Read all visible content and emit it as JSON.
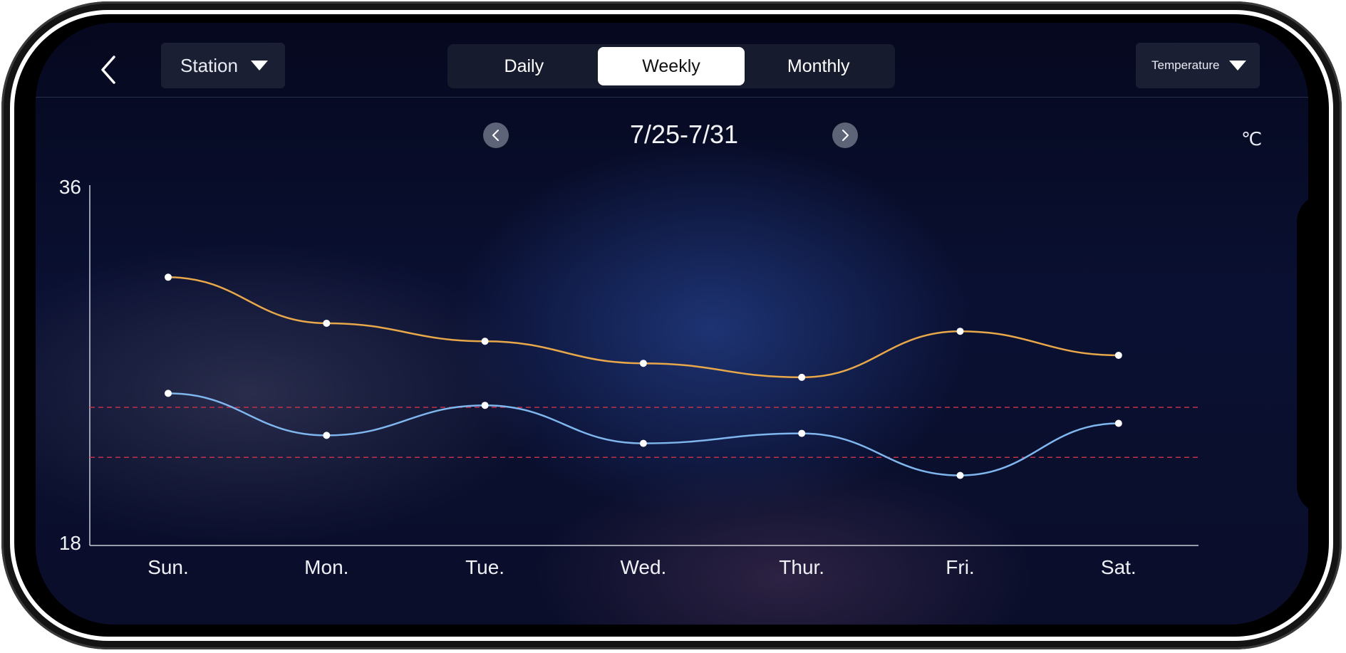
{
  "header": {
    "station_label": "Station",
    "tabs": [
      {
        "label": "Daily",
        "active": false
      },
      {
        "label": "Weekly",
        "active": true
      },
      {
        "label": "Monthly",
        "active": false
      }
    ],
    "metric_label": "Temperature"
  },
  "period": {
    "label": "7/25-7/31"
  },
  "unit": "℃",
  "colors": {
    "high_line": "#e8a84a",
    "low_line": "#7fb6ee",
    "threshold_line": "#c0304a",
    "axis": "#c9ccd6"
  },
  "chart_data": {
    "type": "line",
    "categories": [
      "Sun.",
      "Mon.",
      "Tue.",
      "Wed.",
      "Thur.",
      "Fri.",
      "Sat."
    ],
    "ylim": [
      18,
      36
    ],
    "y_tick_labels": [
      "36",
      "18"
    ],
    "series": [
      {
        "key": "high",
        "values": [
          31.4,
          29.1,
          28.2,
          27.1,
          26.4,
          28.7,
          27.5
        ]
      },
      {
        "key": "low",
        "values": [
          25.6,
          23.5,
          25.0,
          23.1,
          23.6,
          21.5,
          24.1
        ]
      }
    ],
    "threshold_lines": [
      24.9,
      22.4
    ],
    "grid": false,
    "legend": "none"
  }
}
